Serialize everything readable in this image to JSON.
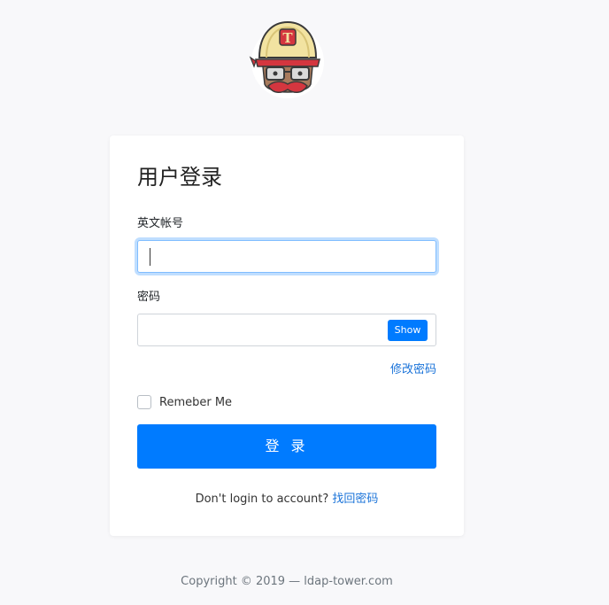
{
  "login": {
    "title": "用户登录",
    "account_label": "英文帐号",
    "account_value": "",
    "password_label": "密码",
    "password_value": "",
    "show_button": "Show",
    "change_password_link": "修改密码",
    "remember_me": "Remeber Me",
    "remember_checked": false,
    "submit_button": "登 录",
    "no_account_text": "Don't login to account?",
    "recover_link": "找回密码"
  },
  "footer": {
    "copyright": "Copyright © 2019 — ldap-tower.com"
  },
  "logo": {
    "icon": "travis-mascot-icon",
    "letter": "T"
  },
  "colors": {
    "accent": "#007bff",
    "link": "#1a73d9",
    "background": "#f8f8fa"
  }
}
